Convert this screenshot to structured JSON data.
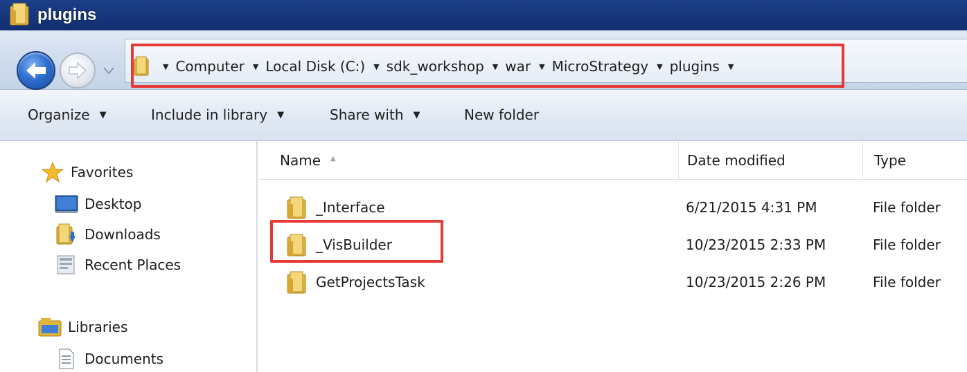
{
  "window": {
    "title": "plugins"
  },
  "nav": {
    "back_label": "Back",
    "forward_label": "Forward",
    "breadcrumbs": [
      "Computer",
      "Local Disk (C:)",
      "sdk_workshop",
      "war",
      "MicroStrategy",
      "plugins"
    ]
  },
  "toolbar": {
    "organize": "Organize",
    "include_in_library": "Include in library",
    "share_with": "Share with",
    "new_folder": "New folder"
  },
  "sidebar": {
    "favorites": "Favorites",
    "desktop": "Desktop",
    "downloads": "Downloads",
    "recent_places": "Recent Places",
    "libraries": "Libraries",
    "documents": "Documents"
  },
  "columns": {
    "name": "Name",
    "date_modified": "Date modified",
    "type": "Type"
  },
  "files": [
    {
      "name": "_Interface",
      "date": "6/21/2015 4:31 PM",
      "type": "File folder"
    },
    {
      "name": "_VisBuilder",
      "date": "10/23/2015 2:33 PM",
      "type": "File folder"
    },
    {
      "name": "GetProjectsTask",
      "date": "10/23/2015 2:26 PM",
      "type": "File folder"
    }
  ],
  "colors": {
    "highlight": "#e53935",
    "titlebar": "#16357a"
  }
}
